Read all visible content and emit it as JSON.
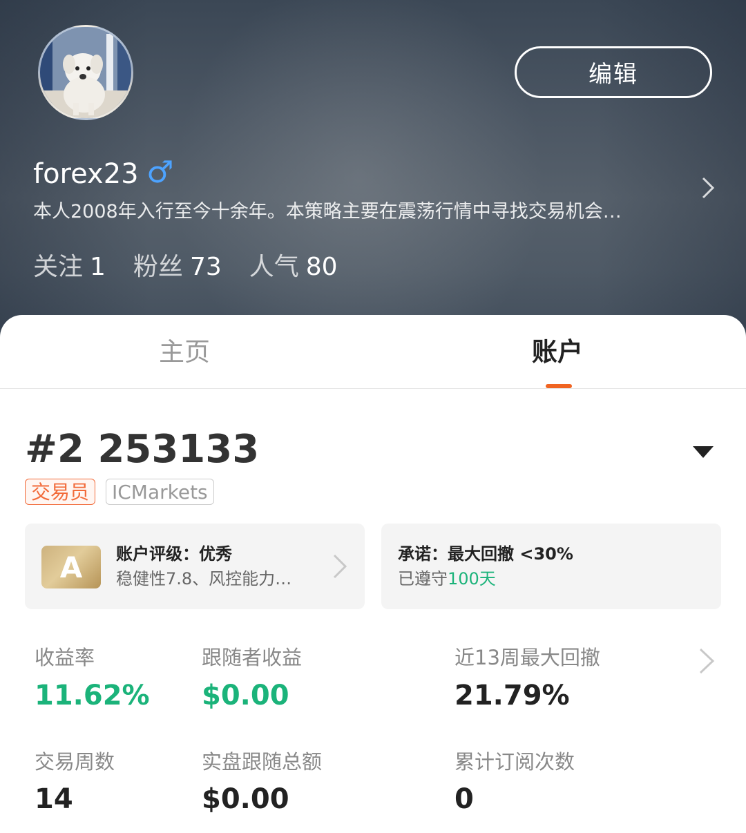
{
  "profile": {
    "edit_label": "编辑",
    "username": "forex23",
    "gender_symbol": "♂",
    "bio": "本人2008年入行至今十余年。本策略主要在震荡行情中寻找交易机会…",
    "stats": [
      {
        "label": "关注",
        "value": "1"
      },
      {
        "label": "粉丝",
        "value": "73"
      },
      {
        "label": "人气",
        "value": "80"
      }
    ]
  },
  "tabs": {
    "home": "主页",
    "account": "账户",
    "active": "account"
  },
  "account": {
    "title": "#2 253133",
    "tag_role": "交易员",
    "tag_broker": "ICMarkets",
    "rating_grade": "A",
    "rating_title": "账户评级：优秀",
    "rating_sub": "稳健性7.8、风控能力…",
    "promise_title": "承诺：最大回撤 <30%",
    "promise_prefix": "已遵守",
    "promise_days": "100天"
  },
  "metrics": [
    {
      "label": "收益率",
      "value": "11.62%",
      "highlight": true
    },
    {
      "label": "跟随者收益",
      "value": "$0.00",
      "highlight": true
    },
    {
      "label": "近13周最大回撤",
      "value": "21.79%",
      "highlight": false
    },
    {
      "label": "交易周数",
      "value": "14",
      "highlight": false
    },
    {
      "label": "实盘跟随总额",
      "value": "$0.00",
      "highlight": false
    },
    {
      "label": "累计订阅次数",
      "value": "0",
      "highlight": false
    }
  ],
  "colors": {
    "accent": "#f06422",
    "positive": "#1bb37a",
    "header_bg": "#4a5562"
  },
  "icons": {
    "avatar": "dog-photo-avatar",
    "chevron": "chevron-right-icon",
    "dropdown": "caret-down-icon"
  }
}
